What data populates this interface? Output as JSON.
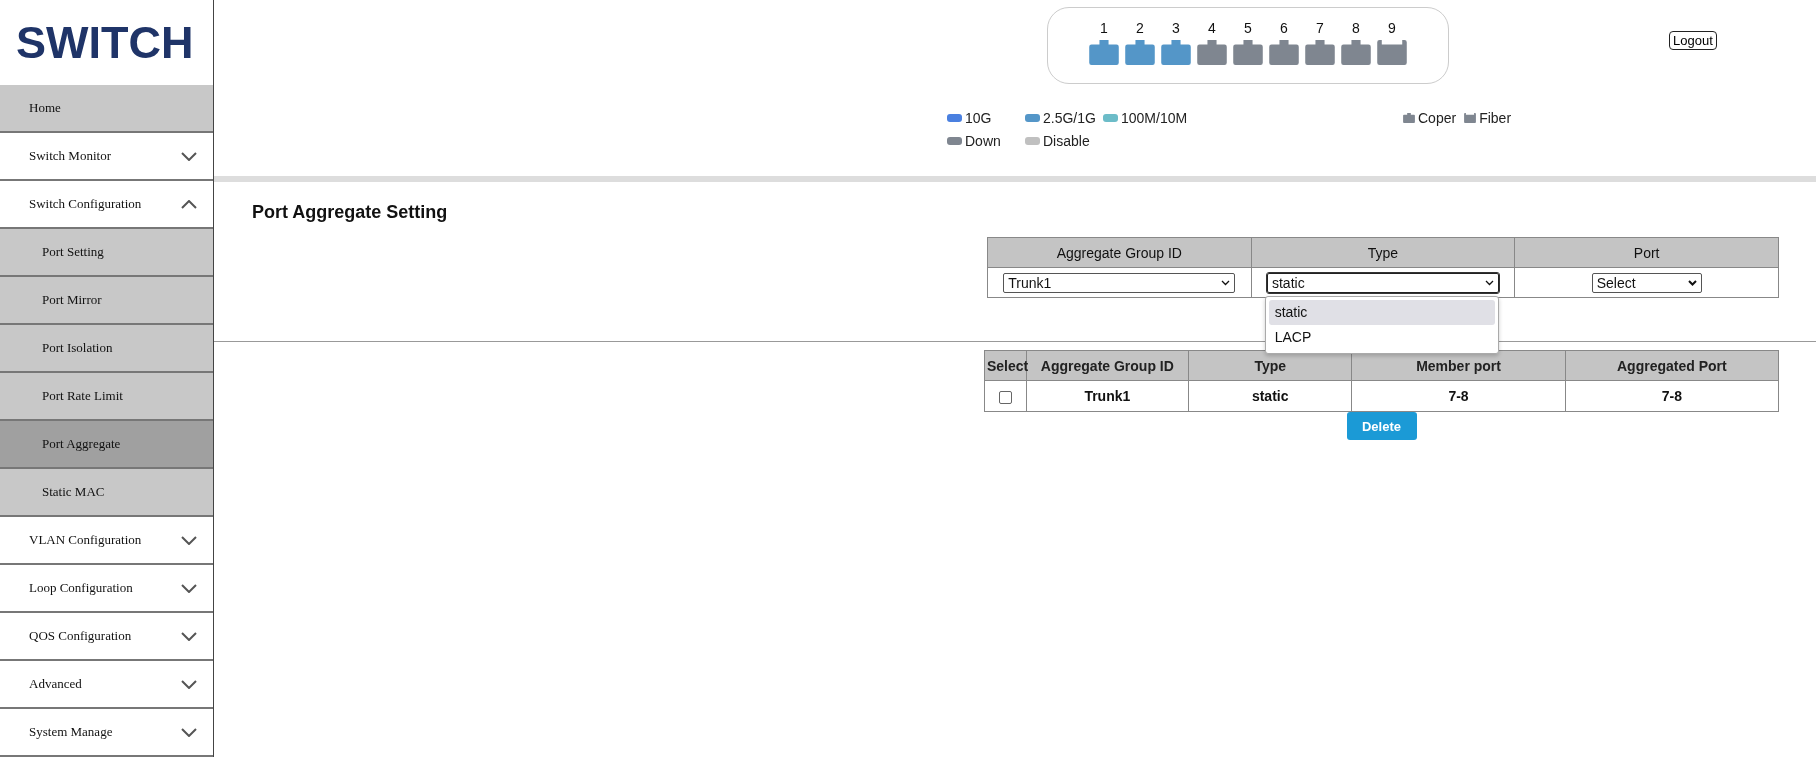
{
  "logo": "SWITCH",
  "sidebar": {
    "items": [
      {
        "label": "Home",
        "kind": "link",
        "selected": false
      },
      {
        "label": "Switch Monitor",
        "kind": "group",
        "expanded": false,
        "selected": false
      },
      {
        "label": "Switch Configuration",
        "kind": "group",
        "expanded": true,
        "selected": false,
        "children": [
          {
            "label": "Port Setting",
            "selected": false
          },
          {
            "label": "Port Mirror",
            "selected": false
          },
          {
            "label": "Port Isolation",
            "selected": false
          },
          {
            "label": "Port Rate Limit",
            "selected": false
          },
          {
            "label": "Port Aggregate",
            "selected": true
          },
          {
            "label": "Static MAC",
            "selected": false
          }
        ]
      },
      {
        "label": "VLAN Configuration",
        "kind": "group",
        "expanded": false,
        "selected": false
      },
      {
        "label": "Loop Configuration",
        "kind": "group",
        "expanded": false,
        "selected": false
      },
      {
        "label": "QOS Configuration",
        "kind": "group",
        "expanded": false,
        "selected": false
      },
      {
        "label": "Advanced",
        "kind": "group",
        "expanded": false,
        "selected": false
      },
      {
        "label": "System Manage",
        "kind": "group",
        "expanded": false,
        "selected": false
      }
    ]
  },
  "ports": [
    {
      "label": "1",
      "kind": "copper",
      "color": "#5496c8"
    },
    {
      "label": "2",
      "kind": "copper",
      "color": "#5496c8"
    },
    {
      "label": "3",
      "kind": "copper",
      "color": "#5496c8"
    },
    {
      "label": "4",
      "kind": "copper",
      "color": "#7f8690"
    },
    {
      "label": "5",
      "kind": "copper",
      "color": "#7f8690"
    },
    {
      "label": "6",
      "kind": "copper",
      "color": "#7f8690"
    },
    {
      "label": "7",
      "kind": "copper",
      "color": "#7f8690"
    },
    {
      "label": "8",
      "kind": "copper",
      "color": "#7f8690"
    },
    {
      "label": "9",
      "kind": "fiber",
      "color": "#7f8690"
    }
  ],
  "logout": "Logout",
  "speed_legend": [
    {
      "label": "10G",
      "color": "#4a80e0"
    },
    {
      "label": "2.5G/1G",
      "color": "#5496c8"
    },
    {
      "label": "100M/10M",
      "color": "#6cbcc8"
    },
    {
      "label": "Down",
      "color": "#7f8690"
    },
    {
      "label": "Disable",
      "color": "#c0c0c0"
    }
  ],
  "media_legend": [
    {
      "label": "Coper",
      "kind": "copper"
    },
    {
      "label": "Fiber",
      "kind": "fiber"
    }
  ],
  "title": "Port Aggregate Setting",
  "form": {
    "columns": [
      "Aggregate Group ID",
      "Type",
      "Port"
    ],
    "group_select": {
      "value": "Trunk1"
    },
    "type_select": {
      "value": "static",
      "expanded": true,
      "options": [
        {
          "label": "static",
          "selected": true
        },
        {
          "label": "LACP",
          "selected": false
        }
      ]
    },
    "port_select": {
      "value": "Select"
    }
  },
  "table": {
    "columns": [
      "Select",
      "Aggregate Group ID",
      "Type",
      "Member port",
      "Aggregated Port"
    ],
    "rows": [
      {
        "cells": [
          {
            "kind": "checkbox",
            "checked": false
          },
          {
            "kind": "text",
            "text": "Trunk1"
          },
          {
            "kind": "text",
            "text": "static"
          },
          {
            "kind": "text",
            "text": "7-8"
          },
          {
            "kind": "text",
            "text": "7-8"
          }
        ]
      }
    ]
  },
  "delete_button": "Delete"
}
